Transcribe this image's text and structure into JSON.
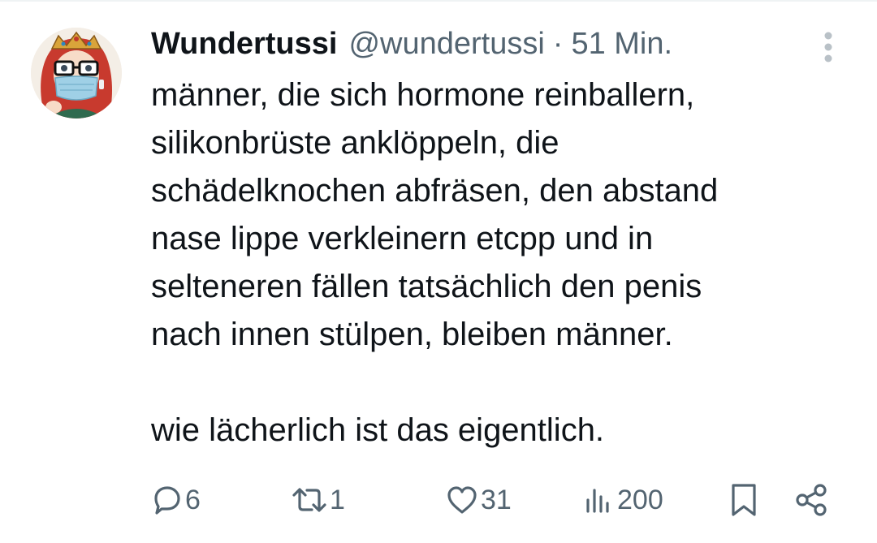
{
  "tweet": {
    "author": {
      "display_name": "Wundertussi",
      "handle": "@wundertussi"
    },
    "separator": "·",
    "timestamp": "51 Min.",
    "text_lines": [
      "männer, die sich hormone reinballern,",
      "silikonbrüste anklöppeln, die",
      "schädelknochen abfräsen, den abstand",
      "nase lippe verkleinern etcpp und in",
      "selteneren fällen tatsächlich den penis",
      "nach innen stülpen, bleiben männer."
    ],
    "text_paragraph_2": "wie lächerlich ist das eigentlich.",
    "actions": {
      "replies": "6",
      "retweets": "1",
      "likes": "31",
      "views": "200"
    },
    "icons": {
      "avatar": "avatar-image",
      "more": "more-vertical-icon",
      "reply": "reply-bubble-icon",
      "retweet": "retweet-icon",
      "like": "heart-icon",
      "views": "views-bar-chart-icon",
      "bookmark": "bookmark-icon",
      "share": "share-icon"
    },
    "colors": {
      "text": "#0f1419",
      "secondary": "#536471"
    }
  }
}
